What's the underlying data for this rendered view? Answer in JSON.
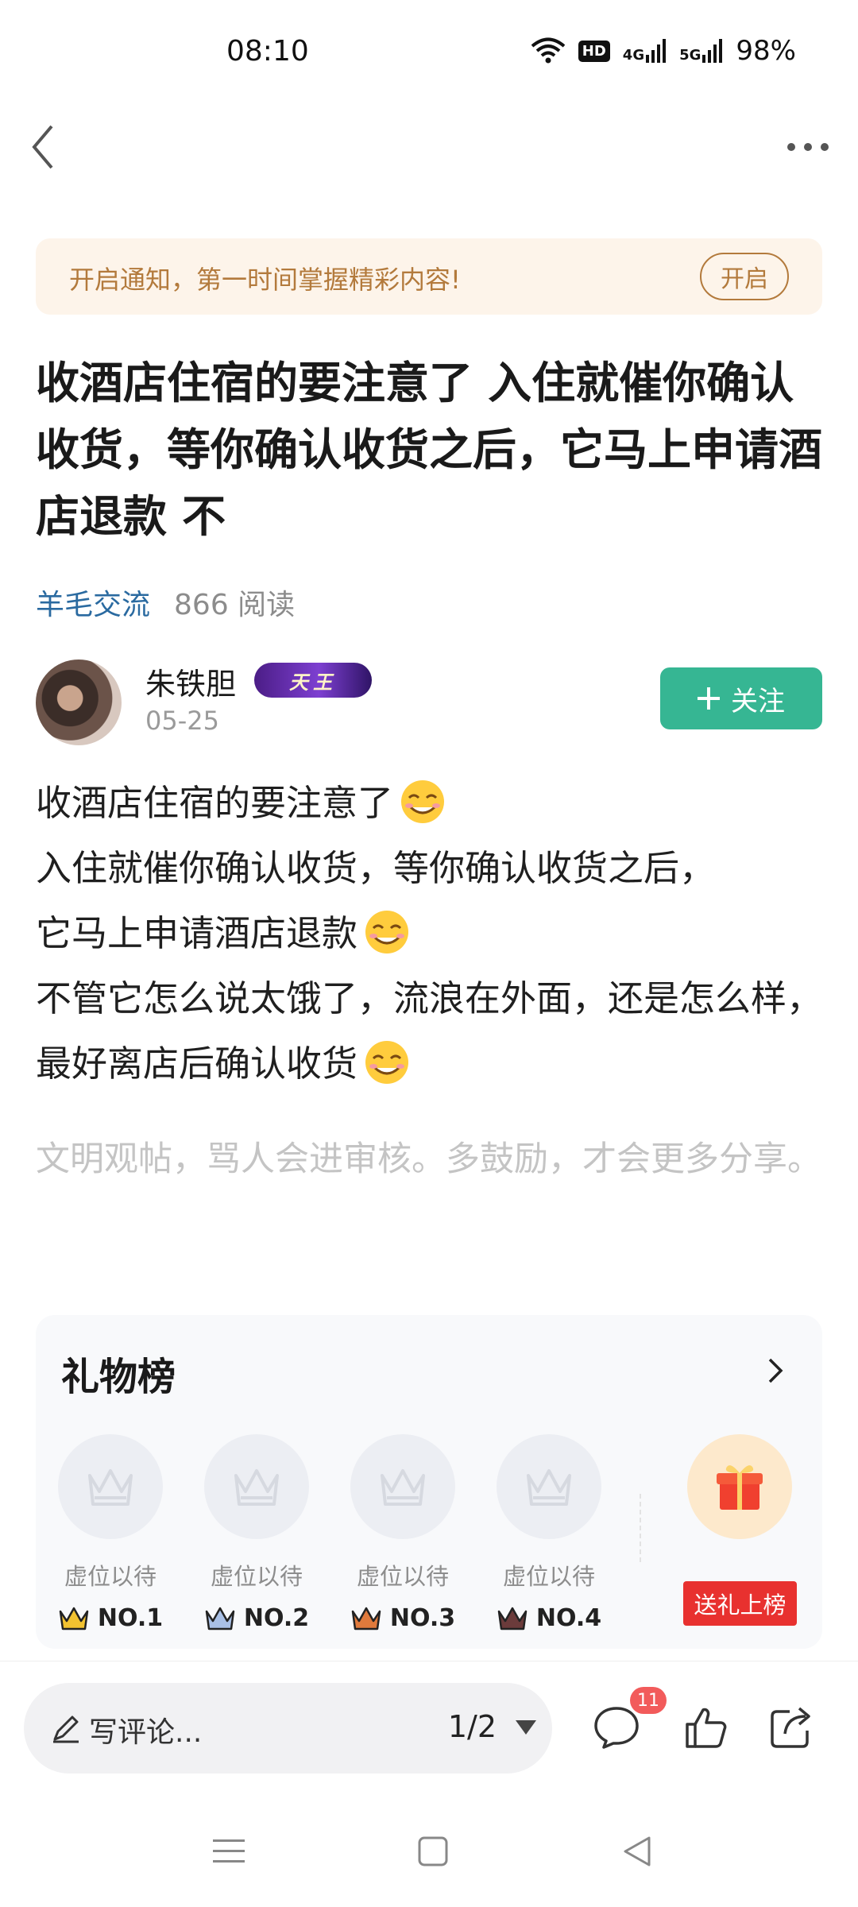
{
  "status_bar": {
    "time": "08:10",
    "hd_label": "HD",
    "net1_label": "4G",
    "net2_label": "5G",
    "battery": "98%"
  },
  "nav": {
    "back_icon": "chevron-left-icon",
    "more_icon": "more-horizontal-icon"
  },
  "notice": {
    "text": "开启通知，第一时间掌握精彩内容!",
    "button": "开启"
  },
  "post": {
    "title": "收酒店住宿的要注意了 入住就催你确认收货，等你确认收货之后，它马上申请酒店退款 不",
    "category": "羊毛交流",
    "reads": "866 阅读",
    "author": {
      "name": "朱铁胆",
      "badge": "天王",
      "date": "05-25",
      "follow_label": "关注"
    },
    "body": {
      "line1": "收酒店住宿的要注意了",
      "line2": "入住就催你确认收货，等你确认收货之后，",
      "line3": "它马上申请酒店退款",
      "line4": "不管它怎么说太饿了，流浪在外面，还是怎么样，最好离店后确认收货",
      "emoji_icon": "grinning-face-emoji"
    },
    "civil_note": "文明观帖，骂人会进审核。多鼓励，才会更多分享。"
  },
  "gift_board": {
    "title": "礼物榜",
    "slots": [
      {
        "label": "虚位以待",
        "rank": "NO.1"
      },
      {
        "label": "虚位以待",
        "rank": "NO.2"
      },
      {
        "label": "虚位以待",
        "rank": "NO.3"
      },
      {
        "label": "虚位以待",
        "rank": "NO.4"
      }
    ],
    "send_button": "送礼上榜",
    "colors": {
      "rank1": "#f2c230",
      "rank2": "#7d9bd1",
      "rank3": "#e07a3c",
      "rank4": "#4a2a2a"
    }
  },
  "comment_bar": {
    "placeholder": "写评论...",
    "page_indicator": "1/2",
    "comment_count": "11"
  },
  "colors": {
    "accent_green": "#36b693",
    "notice_brown": "#b37a3c",
    "category_blue": "#2a6aa0",
    "send_red": "#e8312f"
  }
}
